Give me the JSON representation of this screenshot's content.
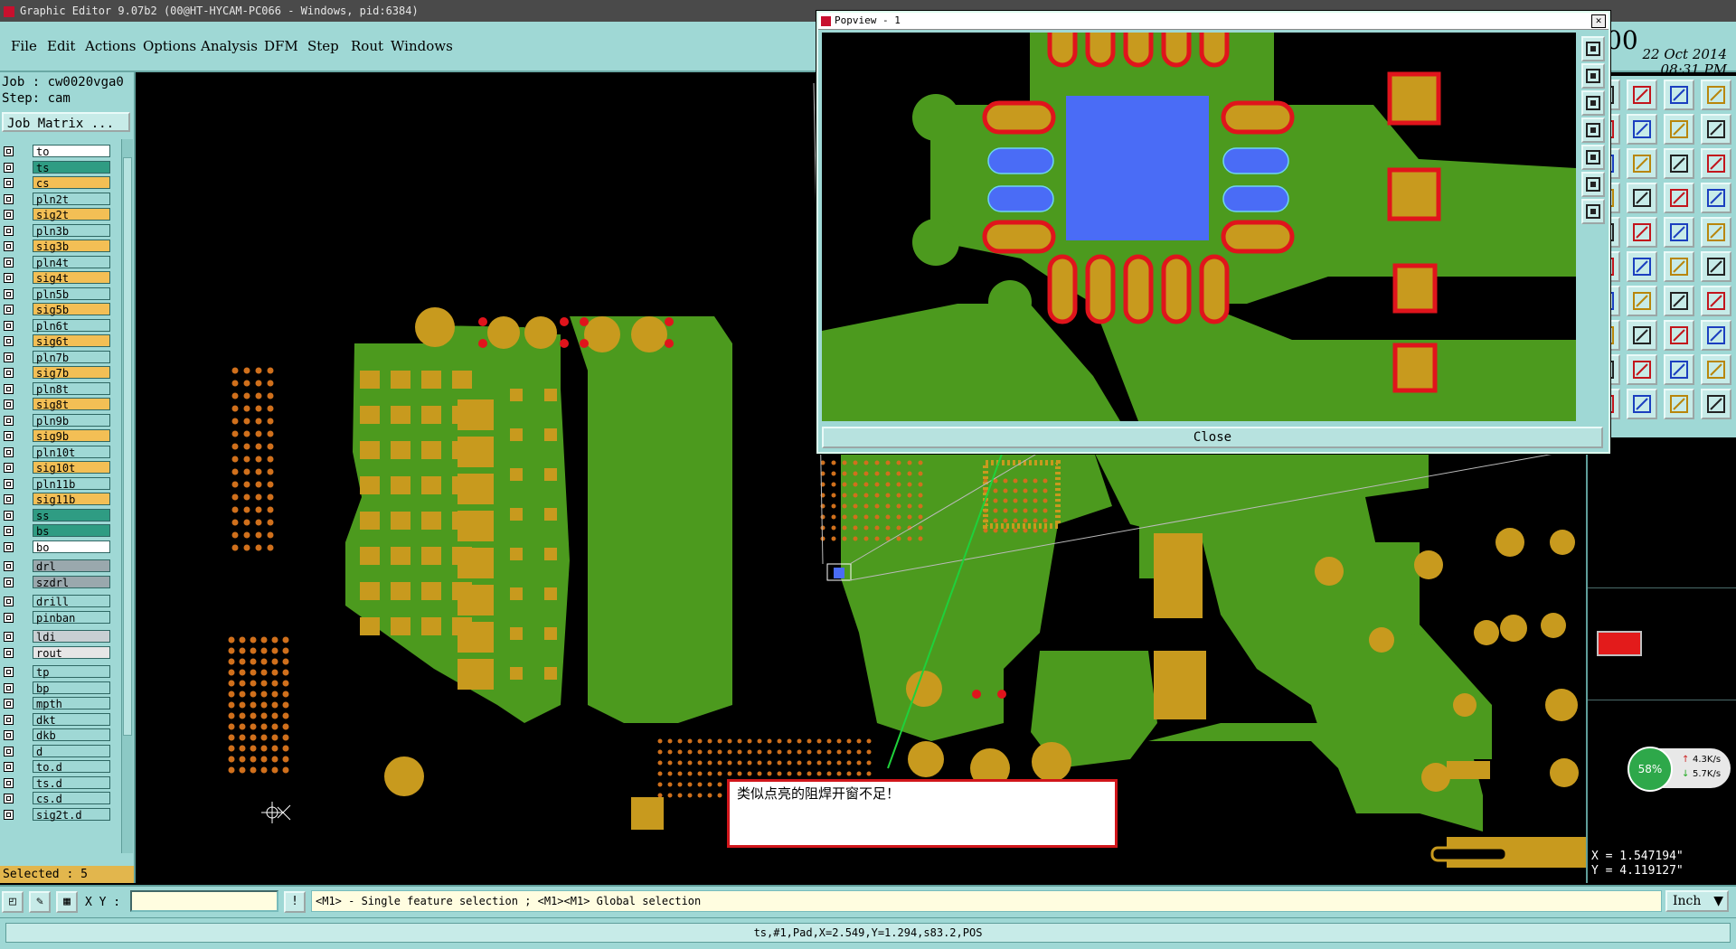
{
  "window": {
    "title": "Graphic Editor 9.07b2 (00@HT-HYCAM-PC066 - Windows, pid:6384)"
  },
  "menu": [
    "File",
    "Edit",
    "Actions",
    "Options",
    "Analysis",
    "DFM",
    "Step",
    "Rout",
    "Windows"
  ],
  "datetime": {
    "date": "22 Oct 2014",
    "time": "08:31 PM",
    "partial": "00"
  },
  "job": {
    "job_line": "Job : cw0020vga0",
    "step_line": "Step: cam",
    "matrix_button": "Job Matrix ..."
  },
  "layers": [
    {
      "name": "to",
      "color": "#ffffff"
    },
    {
      "name": "ts",
      "color": "#2f9c83"
    },
    {
      "name": "cs",
      "color": "#f3bf55"
    },
    {
      "name": "pln2t",
      "color": "#9fd8d5"
    },
    {
      "name": "sig2t",
      "color": "#f3bf55"
    },
    {
      "name": "pln3b",
      "color": "#9fd8d5"
    },
    {
      "name": "sig3b",
      "color": "#f3bf55"
    },
    {
      "name": "pln4t",
      "color": "#9fd8d5"
    },
    {
      "name": "sig4t",
      "color": "#f3bf55"
    },
    {
      "name": "pln5b",
      "color": "#9fd8d5"
    },
    {
      "name": "sig5b",
      "color": "#f3bf55"
    },
    {
      "name": "pln6t",
      "color": "#9fd8d5"
    },
    {
      "name": "sig6t",
      "color": "#f3bf55"
    },
    {
      "name": "pln7b",
      "color": "#9fd8d5"
    },
    {
      "name": "sig7b",
      "color": "#f3bf55"
    },
    {
      "name": "pln8t",
      "color": "#9fd8d5"
    },
    {
      "name": "sig8t",
      "color": "#f3bf55"
    },
    {
      "name": "pln9b",
      "color": "#9fd8d5"
    },
    {
      "name": "sig9b",
      "color": "#f3bf55"
    },
    {
      "name": "pln10t",
      "color": "#9fd8d5"
    },
    {
      "name": "sig10t",
      "color": "#f3bf55"
    },
    {
      "name": "pln11b",
      "color": "#9fd8d5"
    },
    {
      "name": "sig11b",
      "color": "#f3bf55"
    },
    {
      "name": "ss",
      "color": "#2f9c83"
    },
    {
      "name": "bs",
      "color": "#2f9c83"
    },
    {
      "name": "bo",
      "color": "#ffffff"
    },
    {
      "name": "drl",
      "color": "#9aa8ad"
    },
    {
      "name": "szdrl",
      "color": "#9aa8ad"
    },
    {
      "name": "drill",
      "color": "#9fd8d5"
    },
    {
      "name": "pinban",
      "color": "#9fd8d5"
    },
    {
      "name": "ldi",
      "color": "#c8cfd3"
    },
    {
      "name": "rout",
      "color": "#e6e6e6"
    },
    {
      "name": "tp",
      "color": "#9fd8d5"
    },
    {
      "name": "bp",
      "color": "#9fd8d5"
    },
    {
      "name": "mpth",
      "color": "#9fd8d5"
    },
    {
      "name": "dkt",
      "color": "#9fd8d5"
    },
    {
      "name": "dkb",
      "color": "#9fd8d5"
    },
    {
      "name": "d",
      "color": "#9fd8d5"
    },
    {
      "name": "to.d",
      "color": "#9fd8d5"
    },
    {
      "name": "ts.d",
      "color": "#9fd8d5"
    },
    {
      "name": "cs.d",
      "color": "#9fd8d5"
    },
    {
      "name": "sig2t.d",
      "color": "#9fd8d5"
    }
  ],
  "selected": "Selected : 5",
  "toolbar": {
    "xy_label": "X Y :",
    "xy_value": "",
    "hint": "<M1> - Single feature selection ; <M1><M1> Global selection",
    "units": "Inch"
  },
  "status": "ts,#1,Pad,X=2.549,Y=1.294,s83.2,POS",
  "coords": {
    "x": "X = 1.547194\"",
    "y": "Y = 4.119127\""
  },
  "network": {
    "percent": "58%",
    "up": "4.3K/s",
    "down": "5.7K/s"
  },
  "popview": {
    "title": "Popview - 1",
    "close": "Close"
  },
  "annotation": "类似点亮的阻焊开窗不足！",
  "colors": {
    "panel": "#9fd8d5",
    "copper": "#c89a1e",
    "solder": "#4c9a1e",
    "highlight": "#4a6cf6",
    "mask_edge": "#e0141c",
    "arrow": "#1fd13b"
  }
}
